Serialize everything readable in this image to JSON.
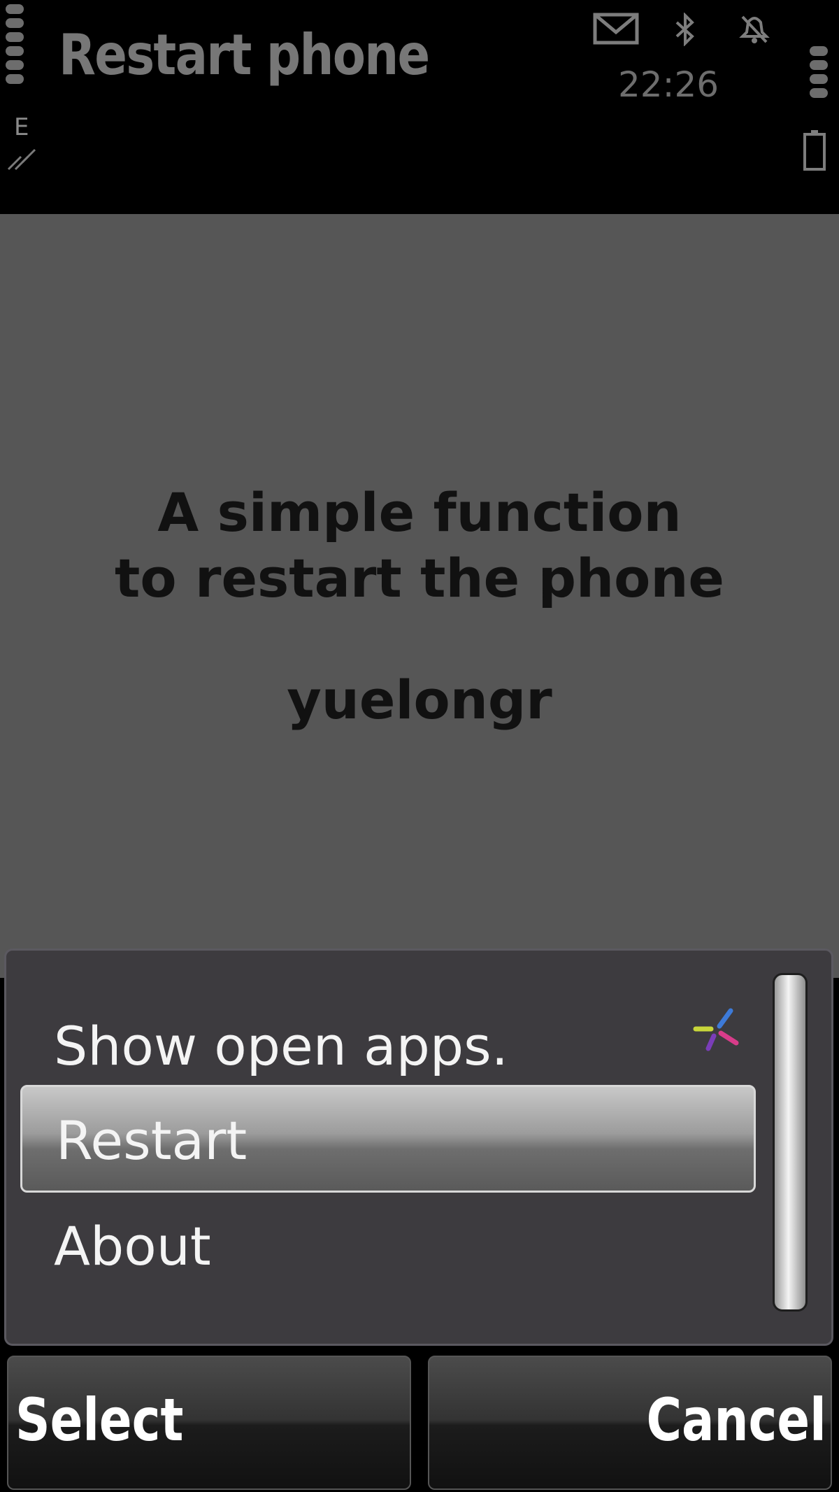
{
  "header": {
    "title": "Restart phone",
    "time": "22:26",
    "network_mode": "E",
    "icons": [
      "signal-strength-icon",
      "mail-icon",
      "bluetooth-icon",
      "alarm-icon",
      "battery-icon"
    ]
  },
  "content": {
    "line1": "A simple function",
    "line2": "to restart the phone",
    "author": "yuelongr"
  },
  "menu": {
    "items": [
      {
        "label": "Show open apps.",
        "icon": "ovi-icon"
      },
      {
        "label": "Restart",
        "selected": true
      },
      {
        "label": "About"
      }
    ]
  },
  "softkeys": {
    "left": "Select",
    "right": "Cancel"
  },
  "colors": {
    "background": "#565656",
    "menu_bg": "#3d3b3f",
    "highlight": "#9c9c9c"
  }
}
